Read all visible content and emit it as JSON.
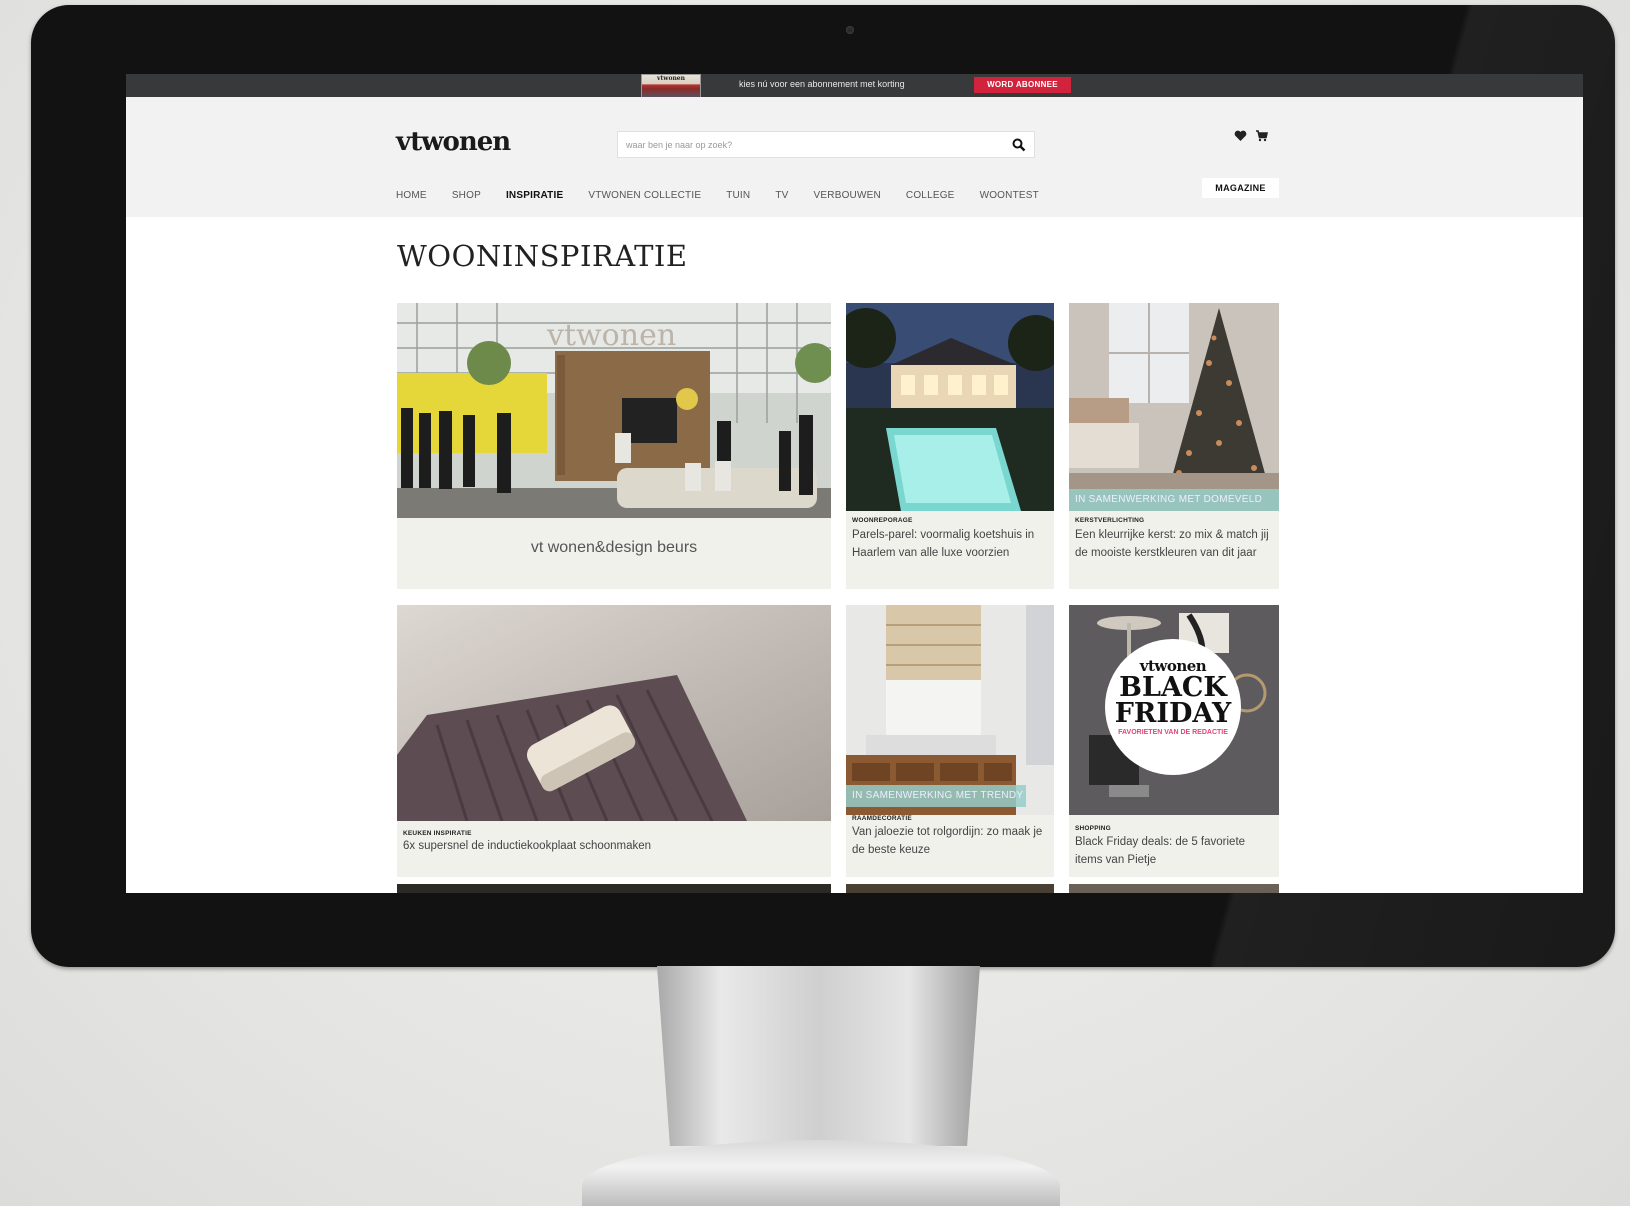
{
  "topbar": {
    "cover_label": "vtwonen",
    "promo_text": "kies nú voor een abonnement met korting",
    "cta_label": "WORD ABONNEE"
  },
  "header": {
    "logo": "vtwonen",
    "search_placeholder": "waar ben je naar op zoek?",
    "nav": [
      "HOME",
      "SHOP",
      "INSPIRATIE",
      "VTWONEN COLLECTIE",
      "TUIN",
      "TV",
      "VERBOUWEN",
      "COLLEGE",
      "WOONTEST"
    ],
    "active_nav": "INSPIRATIE",
    "magazine_label": "MAGAZINE"
  },
  "page": {
    "title": "WOONINSPIRATIE"
  },
  "cards": [
    {
      "title": "vt wonen&design beurs"
    },
    {
      "category": "WOONREPORAGE",
      "title": "Parels-parel: voormalig koetshuis in Haarlem van alle luxe voorzien"
    },
    {
      "category": "KERSTVERLICHTING",
      "title": "Een kleurrijke kerst: zo mix & match jij de mooiste kerstkleuren van dit jaar",
      "ribbon": "IN SAMENWERKING MET DOMEVELD"
    },
    {
      "category": "KEUKEN INSPIRATIE",
      "title": "6x supersnel de inductiekookplaat schoonmaken"
    },
    {
      "category": "RAAMDECORATIE",
      "title": "Van jaloezie tot rolgordijn: zo maak je de beste keuze",
      "ribbon": "IN SAMENWERKING MET TRENDY"
    },
    {
      "category": "SHOPPING",
      "title": "Black Friday deals: de 5 favoriete items van Pietje"
    }
  ],
  "black_friday_badge": {
    "brand": "vtwonen",
    "line1": "BLACK",
    "line2": "FRIDAY",
    "sub": "FAVORIETEN VAN DE REDACTIE"
  },
  "colors": {
    "topbar_bg": "#37393a",
    "cta_red": "#d2233c",
    "header_bg": "#f2f2f2",
    "card_bg": "#f1f1ec",
    "ribbon_teal": "#96cdc8"
  },
  "icons": [
    "search-icon",
    "heart-icon",
    "cart-icon"
  ]
}
